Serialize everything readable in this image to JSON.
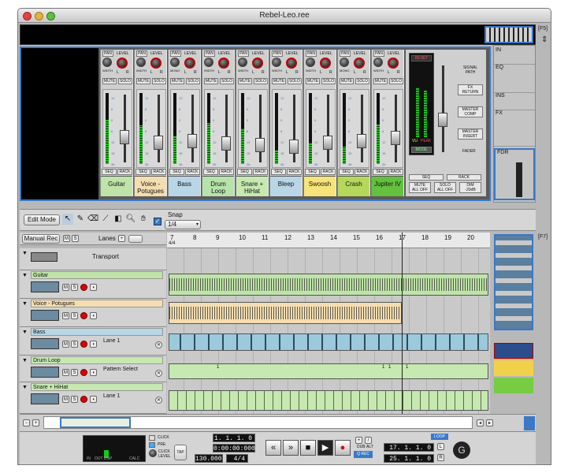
{
  "window": {
    "title": "Rebel-Leo.ree"
  },
  "overview": {
    "shortcut": "[F5]"
  },
  "mixer": {
    "channels": [
      {
        "name": "Guitar",
        "color": "#bfe3a8",
        "width_label": "WIDTH",
        "mono": false
      },
      {
        "name": "Voice -\nPotugues",
        "color": "#f4ddb0",
        "width_label": "WIDTH",
        "mono": false
      },
      {
        "name": "Bass",
        "color": "#b9d6e7",
        "width_label": "MONO",
        "mono": true
      },
      {
        "name": "Drum\nLoop",
        "color": "#b6e3a9",
        "width_label": "WIDTH",
        "mono": false
      },
      {
        "name": "Snare +\nHiHat",
        "color": "#c6e8b1",
        "width_label": "WIDTH",
        "mono": false
      },
      {
        "name": "Bleep",
        "color": "#b9d6e7",
        "width_label": "WIDTH",
        "mono": false
      },
      {
        "name": "Swoosh",
        "color": "#f6e37a",
        "width_label": "WIDTH",
        "mono": false
      },
      {
        "name": "Crash",
        "color": "#b5d85a",
        "width_label": "MONO",
        "mono": true
      },
      {
        "name": "Jupiter IV",
        "color": "#63c13e",
        "width_label": "WIDTH",
        "mono": false
      }
    ],
    "labels": {
      "level": "LEVEL",
      "pan": "PAN",
      "l": "L",
      "r": "R",
      "mute": "MUTE",
      "solo": "SOLO",
      "seq": "SEQ",
      "rack": "RACK"
    },
    "master": {
      "reset": "RESET",
      "vu": "VU",
      "peak": "PEAK",
      "mode": "MODE",
      "signal_path": "SIGNAL\nPATH",
      "fx_return": "FX\nRETURN",
      "master_comp": "MASTER\nCOMP",
      "master_insert": "MASTER\nINSERT",
      "fader": "FADER",
      "seq": "SEQ",
      "rack": "RACK",
      "mute_all_off": "MUTE\nALL OFF",
      "solo_all_off": "SOLO\nALL OFF",
      "dim": "DIM\n-20dB"
    },
    "scale": [
      "12",
      "6",
      "0",
      "6",
      "12",
      "18",
      "36"
    ]
  },
  "right_panel": {
    "rows": [
      "IN",
      "EQ",
      "INS",
      "FX",
      "FDR"
    ]
  },
  "toolbar": {
    "edit_mode": "Edit Mode",
    "snap_label": "Snap",
    "snap_value": "1/4"
  },
  "sequencer": {
    "manual_rec": "Manual Rec",
    "m": "M",
    "s": "S",
    "lanes": "Lanes",
    "add": "+",
    "ruler": [
      "7",
      "8",
      "9",
      "10",
      "11",
      "12",
      "13",
      "14",
      "15",
      "16",
      "17",
      "18",
      "19",
      "20"
    ],
    "ruler_sig": "4/4",
    "tracks": [
      {
        "name": "Transport",
        "color": "#d2d2d2"
      },
      {
        "name": "Guitar",
        "color": "#bfe3a8"
      },
      {
        "name": "Voice - Potugues",
        "color": "#f4ddb0"
      },
      {
        "name": "Bass",
        "color": "#b9d6e7",
        "lane": "Lane 1"
      },
      {
        "name": "Drum Loop",
        "color": "#c6e8b1",
        "lane": "Pattern Select"
      },
      {
        "name": "Snare + HiHat",
        "color": "#c6e8b1",
        "lane": "Lane 1"
      }
    ],
    "clip_labels": [
      "1",
      "1",
      "1",
      "1"
    ],
    "right_shortcut": "[F7]"
  },
  "transport": {
    "click": "CLICK",
    "pre": "PRE",
    "click_level": "CLICK\nLEVEL",
    "tap": "TAP",
    "position": "1. 1. 1.   0",
    "time": "0:00:00:000",
    "tempo": "130.000",
    "signature": "4/4",
    "dub": "DUB",
    "alt": "ALT",
    "q_rec": "Q REC",
    "loop": "LOOP",
    "loop_left": "17. 1. 1.   0",
    "loop_right": "25. 1. 1.   0",
    "l": "L",
    "r": "R",
    "in": "IN",
    "out": "OUT",
    "dsp": "DSP",
    "calc": "CALC"
  }
}
